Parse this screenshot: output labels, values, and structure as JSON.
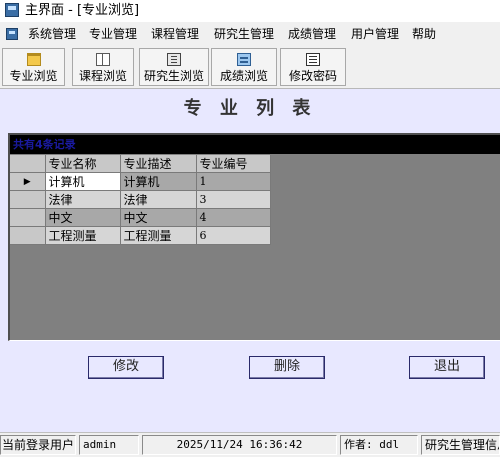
{
  "window": {
    "title": "主界面 - [专业浏览]"
  },
  "menu": [
    "系统管理",
    "专业管理",
    "课程管理",
    "研究生管理",
    "成绩管理",
    "用户管理",
    "帮助"
  ],
  "toolbar": {
    "buttons": [
      {
        "label": "专业浏览",
        "icon": "folder-icon"
      },
      {
        "label": "课程浏览",
        "icon": "book-icon"
      },
      {
        "label": "研究生浏览",
        "icon": "books-icon"
      },
      {
        "label": "成绩浏览",
        "icon": "stack-icon"
      },
      {
        "label": "修改密码",
        "icon": "edit-icon"
      }
    ]
  },
  "page": {
    "title": "专 业 列 表"
  },
  "grid": {
    "caption": "共有4条记录",
    "columns": [
      "专业名称",
      "专业描述",
      "专业编号"
    ],
    "rows": [
      {
        "name": "计算机",
        "desc": "计算机",
        "id": "1",
        "current": true
      },
      {
        "name": "法律",
        "desc": "法律",
        "id": "3"
      },
      {
        "name": "中文",
        "desc": "中文",
        "id": "4"
      },
      {
        "name": "工程测量",
        "desc": "工程测量",
        "id": "6"
      }
    ],
    "current_marker": "▶"
  },
  "buttons": {
    "edit": "修改",
    "delete": "删除",
    "exit": "退出"
  },
  "status": {
    "label": "当前登录用户",
    "user": "admin",
    "datetime": "2025/11/24 16:36:42",
    "author": "作者: ddl",
    "system": "研究生管理信息"
  }
}
